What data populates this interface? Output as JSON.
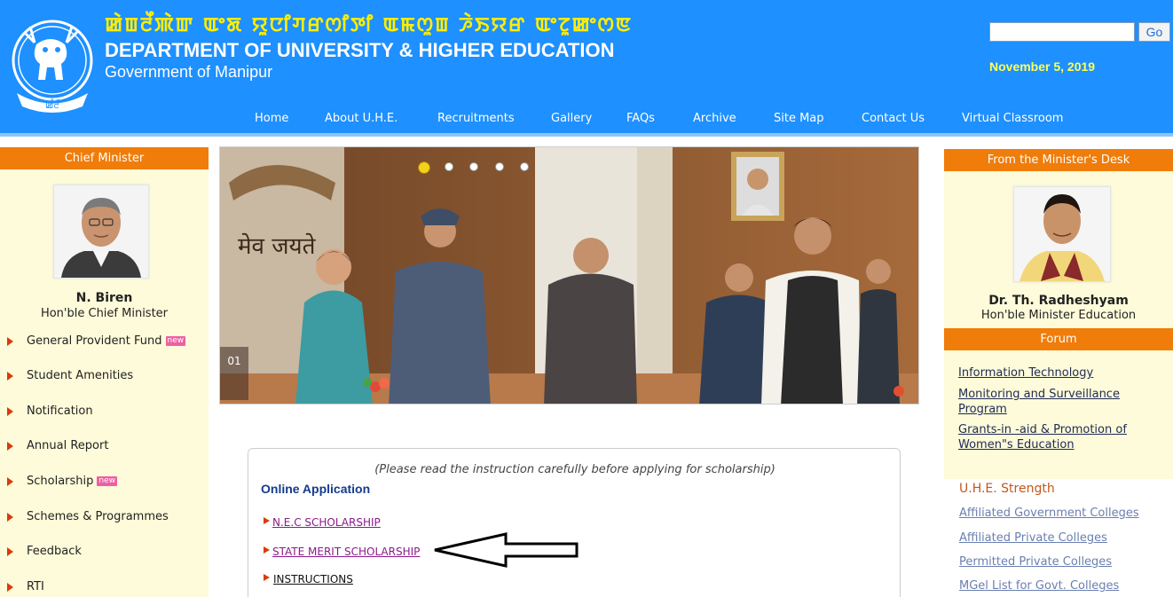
{
  "header": {
    "script_title": "ꯀꯥꯡꯂꯩꯄꯥꯛ ꯑꯦꯗ ꯌꯨꯅꯤꯚꯔꯁꯤꯇꯤ ꯑꯃꯁꯨꯡ ꯍꯥꯏꯌꯔ ꯑꯦꯖꯨꯀꯦꯁꯟ",
    "dept_title": "DEPARTMENT OF UNIVERSITY & HIGHER EDUCATION",
    "subtitle": "Government of Manipur",
    "search_value": "",
    "go_label": "Go",
    "date": "November 5, 2019",
    "emblem_text": "ꯀꯪꯂꯩ"
  },
  "nav": [
    "Home",
    "About U.H.E.",
    "Recruitments",
    "Gallery",
    "FAQs",
    "Archive",
    "Site Map",
    "Contact Us",
    "Virtual Classroom"
  ],
  "left": {
    "heading": "Chief Minister",
    "name": "N. Biren",
    "title": "Hon'ble Chief Minister",
    "menu": [
      {
        "label": "General Provident Fund",
        "badge": "new"
      },
      {
        "label": "Student Amenities",
        "badge": ""
      },
      {
        "label": "Notification",
        "badge": ""
      },
      {
        "label": "Annual Report",
        "badge": ""
      },
      {
        "label": "Scholarship",
        "badge": "new"
      },
      {
        "label": "Schemes & Programmes",
        "badge": ""
      },
      {
        "label": "Feedback",
        "badge": ""
      },
      {
        "label": "RTI",
        "badge": ""
      }
    ]
  },
  "slider": {
    "slide_number": "01",
    "wall_text": "मेव जयते"
  },
  "scholarship": {
    "instruction": "(Please read the instruction carefully before applying for scholarship)",
    "online_application": "Online Application",
    "links": [
      "N.E.C SCHOLARSHIP",
      "STATE MERIT SCHOLARSHIP",
      "INSTRUCTIONS"
    ]
  },
  "right": {
    "heading": "From the Minister's Desk",
    "name": "Dr. Th. Radheshyam",
    "title": "Hon'ble Minister Education",
    "forum_heading": "Forum",
    "forum_links": [
      "Information Technology",
      "Monitoring and Surveillance Program",
      "Grants-in -aid & Promotion of Women\"s Education"
    ],
    "strength_title": "U.H.E. Strength",
    "strength_links": [
      "Affiliated Government Colleges",
      "Affiliated Private Colleges",
      "Permitted Private Colleges",
      "MGel List for Govt. Colleges"
    ]
  }
}
